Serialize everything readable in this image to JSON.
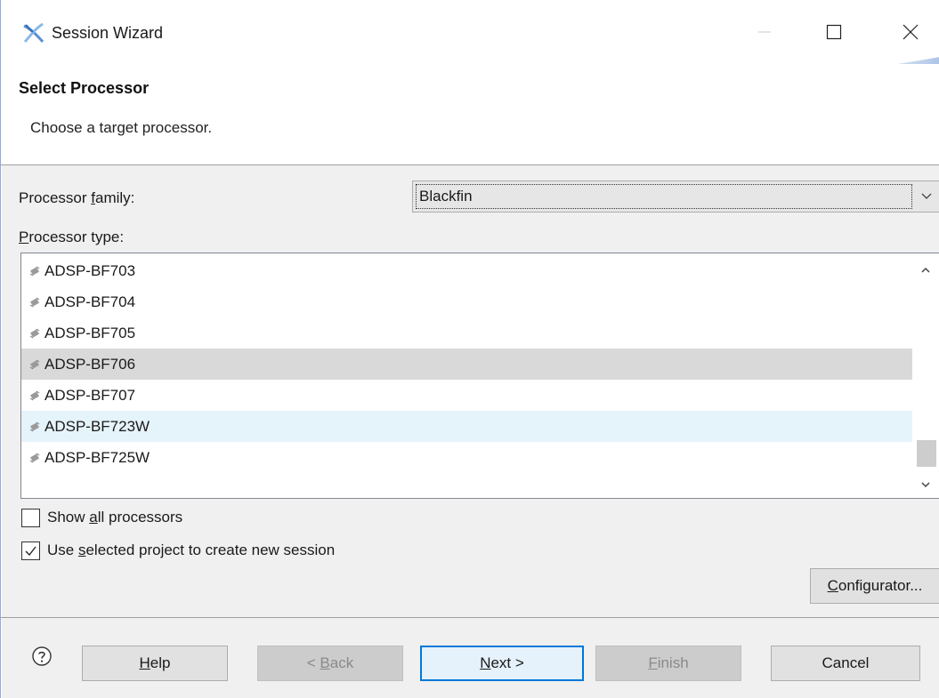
{
  "window": {
    "title": "Session Wizard",
    "controls": {
      "minimize": "minimize",
      "maximize": "maximize",
      "close": "close"
    }
  },
  "header": {
    "title": "Select Processor",
    "description": "Choose a target processor."
  },
  "form": {
    "family_label_pre": "Processor ",
    "family_label_mnemonic": "f",
    "family_label_post": "amily:",
    "family_value": "Blackfin",
    "type_label_mnemonic": "P",
    "type_label_post": "rocessor type:",
    "processors": [
      {
        "name": "ADSP-BF703",
        "state": "normal"
      },
      {
        "name": "ADSP-BF704",
        "state": "normal"
      },
      {
        "name": "ADSP-BF705",
        "state": "normal"
      },
      {
        "name": "ADSP-BF706",
        "state": "selected"
      },
      {
        "name": "ADSP-BF707",
        "state": "normal"
      },
      {
        "name": "ADSP-BF723W",
        "state": "hover"
      },
      {
        "name": "ADSP-BF725W",
        "state": "normal"
      }
    ],
    "show_all": {
      "pre": "Show ",
      "mnemonic": "a",
      "post": "ll processors",
      "checked": false
    },
    "use_selected": {
      "pre": "Use ",
      "mnemonic": "s",
      "post": "elected project to create new session",
      "checked": true
    },
    "configurator": {
      "mnemonic": "C",
      "post": "onfigurator..."
    }
  },
  "footer": {
    "help": {
      "mnemonic": "H",
      "post": "elp"
    },
    "back": {
      "pre": "< ",
      "mnemonic": "B",
      "post": "ack",
      "enabled": false
    },
    "next": {
      "mnemonic": "N",
      "post": "ext >",
      "enabled": true
    },
    "finish": {
      "mnemonic": "F",
      "post": "inish",
      "enabled": false
    },
    "cancel": {
      "label": "Cancel"
    }
  },
  "colors": {
    "content_bg": "#f0f0f0",
    "selected_row": "#d9d9d9",
    "hover_row": "#e5f3fb",
    "default_button_border": "#0078d7"
  }
}
